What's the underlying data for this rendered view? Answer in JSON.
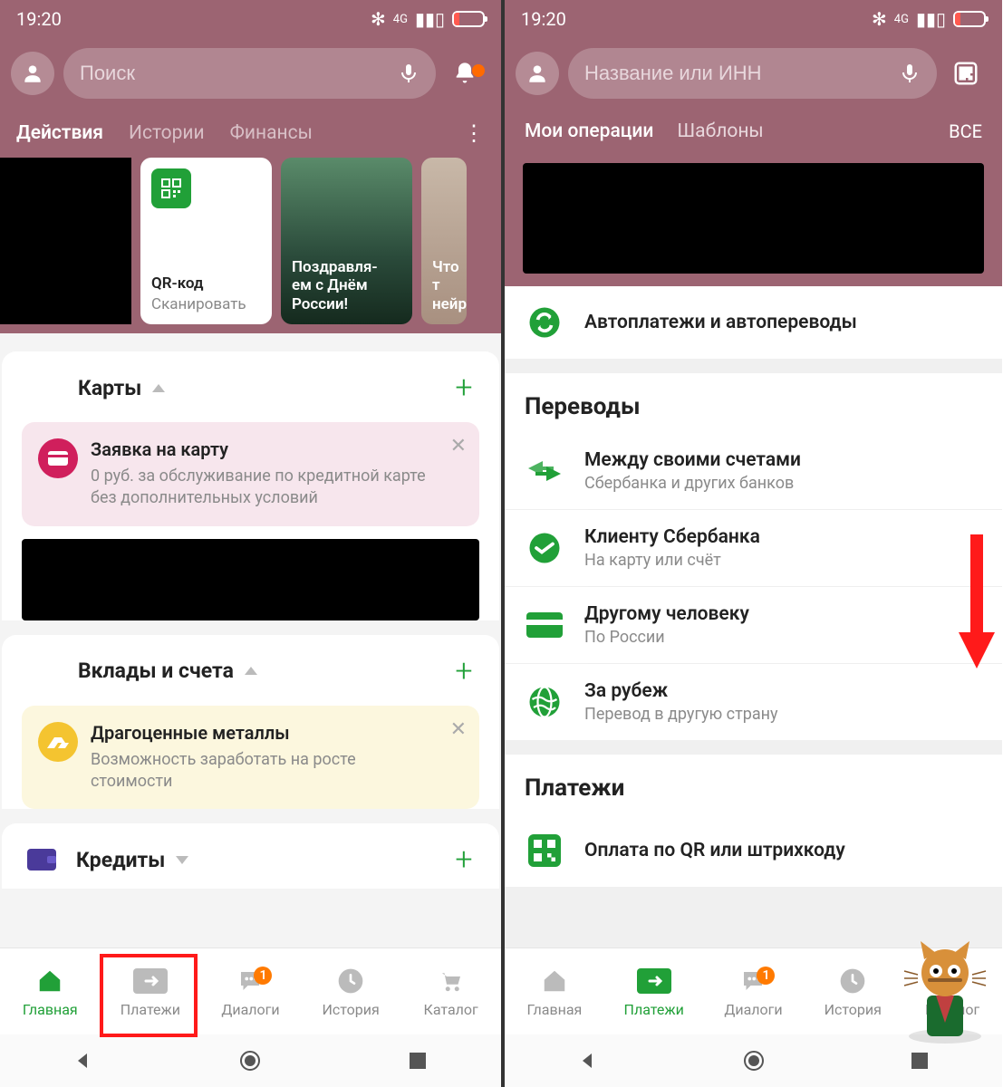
{
  "status": {
    "time": "19:20",
    "network": "4G"
  },
  "screen1": {
    "search_placeholder": "Поиск",
    "tabs": [
      "Действия",
      "Истории",
      "Финансы"
    ],
    "stories": {
      "qr": {
        "title": "QR-код",
        "sub": "Сканировать"
      },
      "s2": "Поздравля-\nем с Днём\nРоссии!",
      "s3": "Что т\nнейро"
    },
    "sections": {
      "cards": "Карты",
      "deposits": "Вклады и счета",
      "credits": "Кредиты"
    },
    "promo1": {
      "title": "Заявка на карту",
      "text": "0 руб. за обслуживание по кредитной карте без дополнительных условий"
    },
    "promo2": {
      "title": "Драгоценные металлы",
      "text": "Возможность заработать на росте стоимости"
    },
    "nav": {
      "home": "Главная",
      "payments": "Платежи",
      "dialogs": "Диалоги",
      "history": "История",
      "catalog": "Каталог",
      "badge": "1"
    }
  },
  "screen2": {
    "search_placeholder": "Название или ИНН",
    "ops": {
      "my": "Мои операции",
      "tpl": "Шаблоны",
      "all": "ВСЕ"
    },
    "autopay": "Автоплатежи и автопереводы",
    "transfers_header": "Переводы",
    "transfers": [
      {
        "title": "Между своими счетами",
        "sub": "Сбербанка и других банков"
      },
      {
        "title": "Клиенту Сбербанка",
        "sub": "На карту или счёт"
      },
      {
        "title": "Другому человеку",
        "sub": "По России"
      },
      {
        "title": "За рубеж",
        "sub": "Перевод в другую страну"
      }
    ],
    "payments_header": "Платежи",
    "pay_qr": "Оплата по QR или штрихкоду",
    "nav": {
      "home": "Главная",
      "payments": "Платежи",
      "dialogs": "Диалоги",
      "history": "История",
      "catalog": "Каталог",
      "badge": "1"
    }
  }
}
